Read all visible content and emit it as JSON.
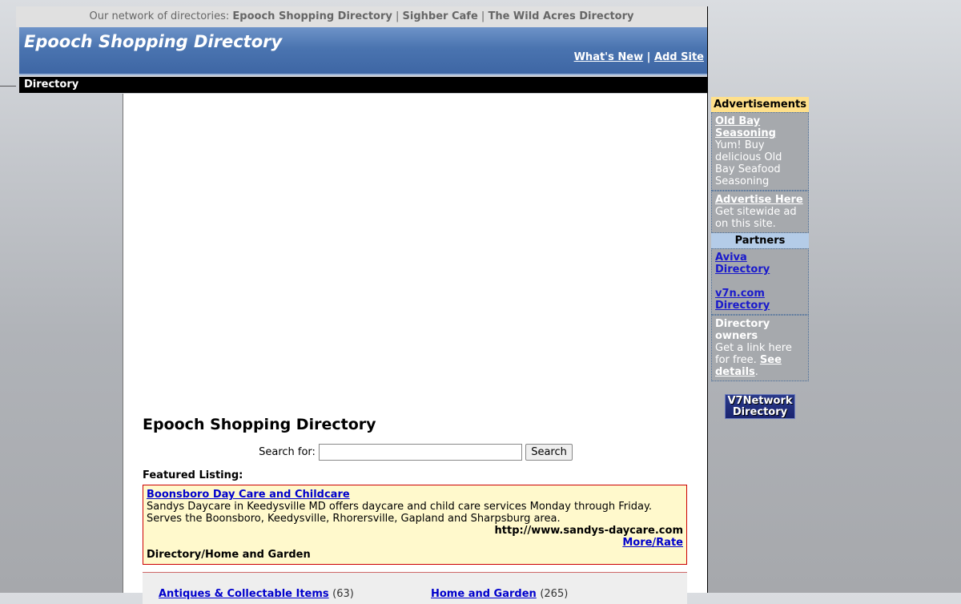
{
  "network": {
    "label": "Our network of directories:",
    "links": [
      "Epooch Shopping Directory",
      "Sighber Cafe",
      "The Wild Acres Directory"
    ],
    "separator": "|"
  },
  "header": {
    "title": "Epooch Shopping Directory",
    "links": [
      "What's New",
      "Add Site"
    ],
    "separator": "|"
  },
  "nav": {
    "label": "Directory"
  },
  "main": {
    "title": "Epooch Shopping Directory",
    "search": {
      "label": "Search for:",
      "value": "",
      "button": "Search"
    },
    "featured": {
      "label": "Featured Listing:",
      "title": "Boonsboro Day Care and Childcare",
      "description": "Sandys Daycare in Keedysville MD offers daycare and child care services Monday through Friday. Serves the Boonsboro, Keedysville, Rhorersville, Gapland and Sharpsburg area.",
      "url": "http://www.sandys-daycare.com",
      "more": "More/Rate",
      "category": "Directory/Home and Garden"
    },
    "categories": [
      {
        "name": "Antiques & Collectable Items",
        "count": "(63)"
      },
      {
        "name": "Home and Garden",
        "count": "(265)"
      }
    ]
  },
  "sidebar": {
    "ads_header": "Advertisements",
    "ads": [
      {
        "title": "Old Bay Seasoning",
        "text": "Yum! Buy delicious Old Bay Seafood Seasoning"
      },
      {
        "title": "Advertise Here",
        "text": "Get sitewide ad on this site."
      }
    ],
    "partners_header": "Partners",
    "partners": [
      "Aviva Directory",
      "v7n.com Directory"
    ],
    "owners": {
      "title": "Directory owners",
      "text": "Get a link here for free.",
      "link": "See details",
      "suffix": "."
    },
    "badge": {
      "line1": "V7Network",
      "line2": "Directory"
    }
  }
}
